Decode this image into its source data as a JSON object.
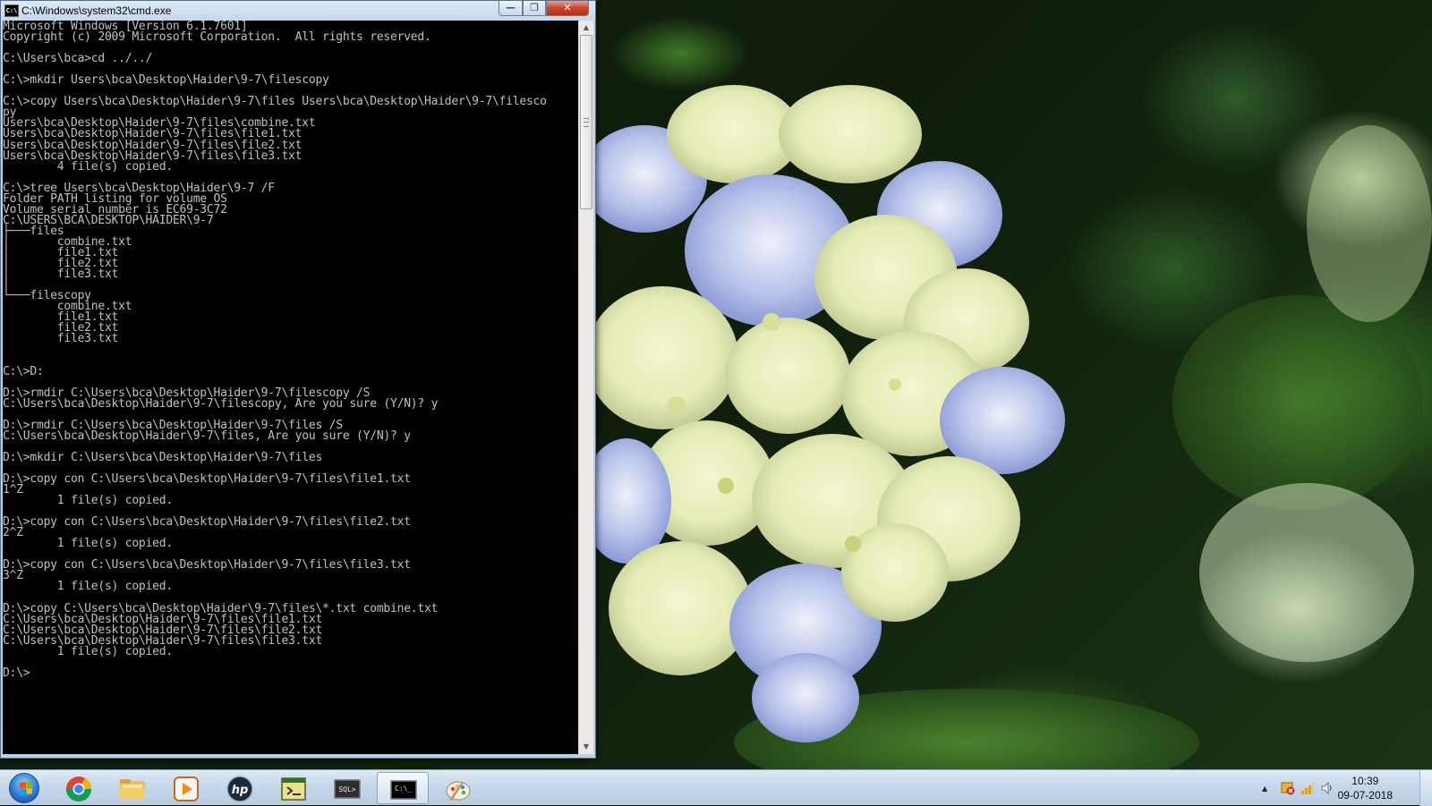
{
  "window": {
    "title": "C:\\Windows\\system32\\cmd.exe",
    "icon": "cmd-icon",
    "icon_text": "C:\\",
    "minimize_symbol": "—",
    "maximize_symbol": "❐",
    "close_symbol": "✕"
  },
  "console": {
    "lines": [
      "Microsoft Windows [Version 6.1.7601]",
      "Copyright (c) 2009 Microsoft Corporation.  All rights reserved.",
      "",
      "C:\\Users\\bca>cd ../../",
      "",
      "C:\\>mkdir Users\\bca\\Desktop\\Haider\\9-7\\filescopy",
      "",
      "C:\\>copy Users\\bca\\Desktop\\Haider\\9-7\\files Users\\bca\\Desktop\\Haider\\9-7\\filesco",
      "py",
      "Users\\bca\\Desktop\\Haider\\9-7\\files\\combine.txt",
      "Users\\bca\\Desktop\\Haider\\9-7\\files\\file1.txt",
      "Users\\bca\\Desktop\\Haider\\9-7\\files\\file2.txt",
      "Users\\bca\\Desktop\\Haider\\9-7\\files\\file3.txt",
      "        4 file(s) copied.",
      "",
      "C:\\>tree Users\\bca\\Desktop\\Haider\\9-7 /F",
      "Folder PATH listing for volume OS",
      "Volume serial number is EC69-3C72",
      "C:\\USERS\\BCA\\DESKTOP\\HAIDER\\9-7",
      "├───files",
      "│       combine.txt",
      "│       file1.txt",
      "│       file2.txt",
      "│       file3.txt",
      "│",
      "└───filescopy",
      "        combine.txt",
      "        file1.txt",
      "        file2.txt",
      "        file3.txt",
      "",
      "",
      "C:\\>D:",
      "",
      "D:\\>rmdir C:\\Users\\bca\\Desktop\\Haider\\9-7\\filescopy /S",
      "C:\\Users\\bca\\Desktop\\Haider\\9-7\\filescopy, Are you sure (Y/N)? y",
      "",
      "D:\\>rmdir C:\\Users\\bca\\Desktop\\Haider\\9-7\\files /S",
      "C:\\Users\\bca\\Desktop\\Haider\\9-7\\files, Are you sure (Y/N)? y",
      "",
      "D:\\>mkdir C:\\Users\\bca\\Desktop\\Haider\\9-7\\files",
      "",
      "D:\\>copy con C:\\Users\\bca\\Desktop\\Haider\\9-7\\files\\file1.txt",
      "1^Z",
      "        1 file(s) copied.",
      "",
      "D:\\>copy con C:\\Users\\bca\\Desktop\\Haider\\9-7\\files\\file2.txt",
      "2^Z",
      "        1 file(s) copied.",
      "",
      "D:\\>copy con C:\\Users\\bca\\Desktop\\Haider\\9-7\\files\\file3.txt",
      "3^Z",
      "        1 file(s) copied.",
      "",
      "D:\\>copy C:\\Users\\bca\\Desktop\\Haider\\9-7\\files\\*.txt combine.txt",
      "C:\\Users\\bca\\Desktop\\Haider\\9-7\\files\\file1.txt",
      "C:\\Users\\bca\\Desktop\\Haider\\9-7\\files\\file2.txt",
      "C:\\Users\\bca\\Desktop\\Haider\\9-7\\files\\file3.txt",
      "        1 file(s) copied.",
      "",
      "D:\\>"
    ],
    "colors": {
      "background": "#000000",
      "foreground": "#c0c0c0"
    }
  },
  "scrollbar": {
    "up_arrow": "▲",
    "down_arrow": "▼"
  },
  "taskbar": {
    "pinned": [
      {
        "name": "chrome-icon"
      },
      {
        "name": "file-explorer-icon"
      },
      {
        "name": "media-player-icon"
      },
      {
        "name": "hp-icon"
      },
      {
        "name": "script-app-icon"
      },
      {
        "name": "sql-icon",
        "text": "SQL>"
      },
      {
        "name": "cmd-icon",
        "text": "C:\\_",
        "active": true
      },
      {
        "name": "paint-icon"
      }
    ],
    "tray": {
      "show_hidden_symbol": "▲",
      "icons": [
        "security-alert-icon",
        "network-signal-icon",
        "volume-icon"
      ]
    },
    "clock": {
      "time": "10:39",
      "date": "09-07-2018"
    }
  }
}
